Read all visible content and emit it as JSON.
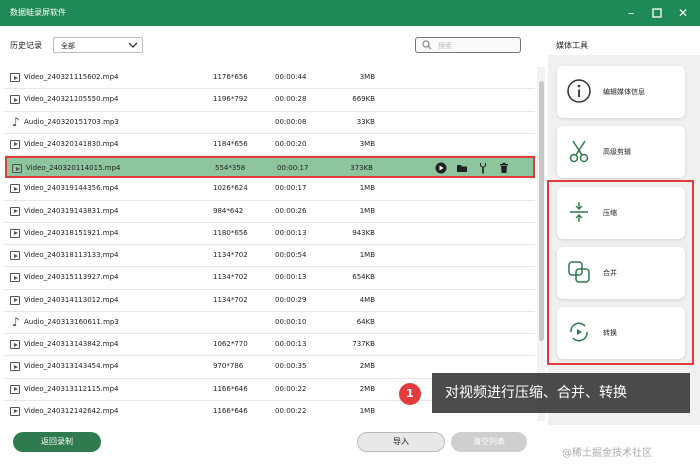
{
  "window": {
    "title": "数据蛙录屏软件"
  },
  "toolbar": {
    "history_label": "历史记录",
    "filter_value": "全部",
    "search_placeholder": "搜索"
  },
  "files": [
    {
      "type": "video",
      "name": "Video_240321115602.mp4",
      "resolution": "1176*656",
      "duration": "00:00:44",
      "size": "3MB"
    },
    {
      "type": "video",
      "name": "Video_240321105550.mp4",
      "resolution": "1196*792",
      "duration": "00:00:28",
      "size": "669KB"
    },
    {
      "type": "audio",
      "name": "Audio_240320151703.mp3",
      "resolution": "",
      "duration": "00:00:08",
      "size": "33KB"
    },
    {
      "type": "video",
      "name": "Video_240320141830.mp4",
      "resolution": "1184*656",
      "duration": "00:00:20",
      "size": "3MB"
    },
    {
      "type": "video",
      "name": "Video_240320114015.mp4",
      "resolution": "554*358",
      "duration": "00:00:17",
      "size": "373KB",
      "selected": true
    },
    {
      "type": "video",
      "name": "Video_240319144356.mp4",
      "resolution": "1026*624",
      "duration": "00:00:17",
      "size": "1MB"
    },
    {
      "type": "video",
      "name": "Video_240319143831.mp4",
      "resolution": "984*642",
      "duration": "00:00:26",
      "size": "1MB"
    },
    {
      "type": "video",
      "name": "Video_240318151921.mp4",
      "resolution": "1180*656",
      "duration": "00:00:13",
      "size": "943KB"
    },
    {
      "type": "video",
      "name": "Video_240318113133.mp4",
      "resolution": "1134*702",
      "duration": "00:00:54",
      "size": "1MB"
    },
    {
      "type": "video",
      "name": "Video_240315113927.mp4",
      "resolution": "1134*702",
      "duration": "00:00:13",
      "size": "654KB"
    },
    {
      "type": "video",
      "name": "Video_240314113012.mp4",
      "resolution": "1134*702",
      "duration": "00:00:29",
      "size": "4MB"
    },
    {
      "type": "audio",
      "name": "Audio_240313160611.mp3",
      "resolution": "",
      "duration": "00:00:10",
      "size": "64KB"
    },
    {
      "type": "video",
      "name": "Video_240313143842.mp4",
      "resolution": "1062*770",
      "duration": "00:00:13",
      "size": "737KB"
    },
    {
      "type": "video",
      "name": "Video_240313143454.mp4",
      "resolution": "970*786",
      "duration": "00:00:35",
      "size": "2MB"
    },
    {
      "type": "video",
      "name": "Video_240313112115.mp4",
      "resolution": "1166*646",
      "duration": "00:00:22",
      "size": "2MB"
    },
    {
      "type": "video",
      "name": "Video_240312142642.mp4",
      "resolution": "1166*646",
      "duration": "00:00:22",
      "size": "1MB"
    }
  ],
  "row_actions": [
    "play-icon",
    "folder-icon",
    "wrench-icon",
    "trash-icon"
  ],
  "tools": {
    "title": "媒体工具",
    "items": [
      {
        "label": "编辑媒体信息",
        "icon": "info-icon"
      },
      {
        "label": "高级剪辑",
        "icon": "scissors-icon"
      },
      {
        "label": "压缩",
        "icon": "compress-icon"
      },
      {
        "label": "合并",
        "icon": "merge-icon"
      },
      {
        "label": "转换",
        "icon": "convert-icon"
      }
    ]
  },
  "buttons": {
    "back": "返回录制",
    "import": "导入",
    "clear": "清空列表"
  },
  "callout": {
    "badge": "1",
    "text": "对视频进行压缩、合并、转换"
  },
  "watermark": "@稀土掘金技术社区",
  "colors": {
    "accent": "#1f8a57",
    "selected_row": "#8dc59e",
    "highlight": "#e23b3b"
  }
}
